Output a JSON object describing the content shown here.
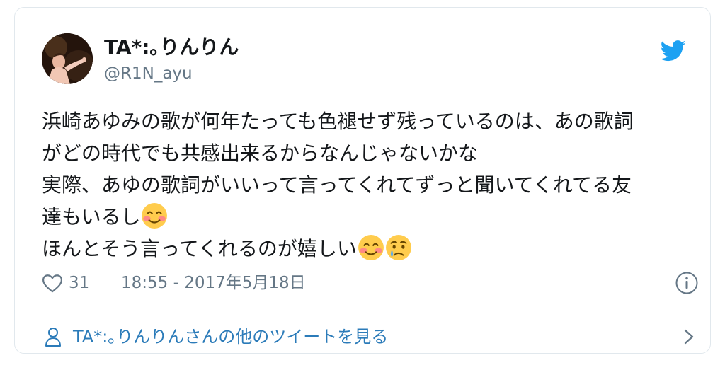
{
  "tweet": {
    "display_name": "TA*:｡りんりん",
    "handle": "@R1N_ayu",
    "text_lines": [
      "浜崎あゆみの歌が何年たっても色褪せず残っているのは、あの歌詞",
      "がどの時代でも共感出来るからなんじゃないかな",
      "実際、あゆの歌詞がいいって言ってくれてずっと聞いてくれてる友",
      "達もいるし",
      "ほんとそう言ってくれるのが嬉しい"
    ],
    "emoji": [
      "smiling-blush-emoji",
      "smiling-blush-emoji",
      "crying-face-emoji"
    ],
    "likes": "31",
    "timestamp": "18:55 - 2017年5月18日"
  },
  "footer": {
    "more_tweets_label": "TA*:｡りんりんさんの他のツイートを見る"
  },
  "icons": {
    "brand": "twitter-bird-icon",
    "like": "heart-icon",
    "info": "info-icon",
    "user": "person-icon",
    "next": "chevron-right-icon"
  },
  "colors": {
    "brand_blue": "#1da1f2",
    "link_blue": "#2b7bb9",
    "secondary_text": "#657786",
    "border": "#e1e8ed"
  }
}
